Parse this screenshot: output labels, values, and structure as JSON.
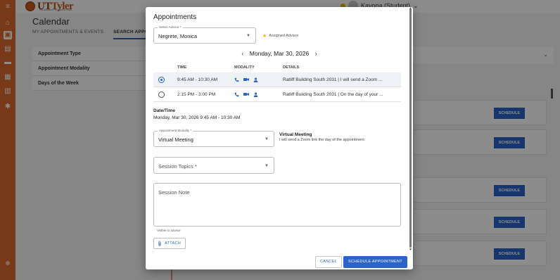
{
  "app": {
    "logo_text_a": "UT",
    "logo_text_b": "Tyler",
    "logo_subtext": "THE UNIVERSITY OF TEXAS AT TYLER",
    "user_name": "Kayona (Student)",
    "page_title": "Calendar",
    "tabs": [
      {
        "label": "MY APPOINTMENTS & EVENTS"
      },
      {
        "label": "SEARCH APPOINTMENTS"
      }
    ],
    "filters": [
      {
        "label": "Appointment Type"
      },
      {
        "label": "Appointment Modality"
      },
      {
        "label": "Days of the Week"
      }
    ],
    "schedule_label": "SCHEDULE",
    "rail_icons": [
      "menu-icon",
      "home-icon",
      "calendar-icon",
      "messages-icon",
      "folder-icon",
      "briefcase-icon",
      "book-icon",
      "gear-icon"
    ],
    "accent_color": "#d9692a",
    "primary_color": "#2b63c6"
  },
  "modal": {
    "title": "Appointments",
    "advisor": {
      "label": "Select Advisor *",
      "value": "Negrete, Monica",
      "assigned_text": "Assigned Advisor"
    },
    "date_nav": {
      "date": "Monday, Mar 30, 2026",
      "prev": "‹",
      "next": "›"
    },
    "table": {
      "headers": {
        "time": "TIME",
        "modality": "MODALITY",
        "details": "DETAILS"
      },
      "rows": [
        {
          "time": "9:45 AM - 10:30 AM",
          "details": "Ratliff Building South 2031 | I will send a Zoom ...",
          "selected": true
        },
        {
          "time": "2:15 PM - 3:00 PM",
          "details": "Ratliff Building South 2031 | On the day of your ...",
          "selected": false
        }
      ]
    },
    "datetime": {
      "label": "Date/Time",
      "value": "Monday, Mar 30, 2026 9:45 AM - 10:30 AM"
    },
    "modality": {
      "label": "Appointment Modality *",
      "value": "Virtual Meeting",
      "info_title": "Virtual Meeting",
      "info_desc": "I will send a Zoom link the day of the appointment"
    },
    "topics": {
      "placeholder": "Session Topics *"
    },
    "note": {
      "placeholder": "Session Note",
      "helper": "Visible to advisor"
    },
    "attach_label": "ATTACH",
    "cancel_label": "CANCEL",
    "submit_label": "SCHEDULE APPOINTMENT"
  }
}
